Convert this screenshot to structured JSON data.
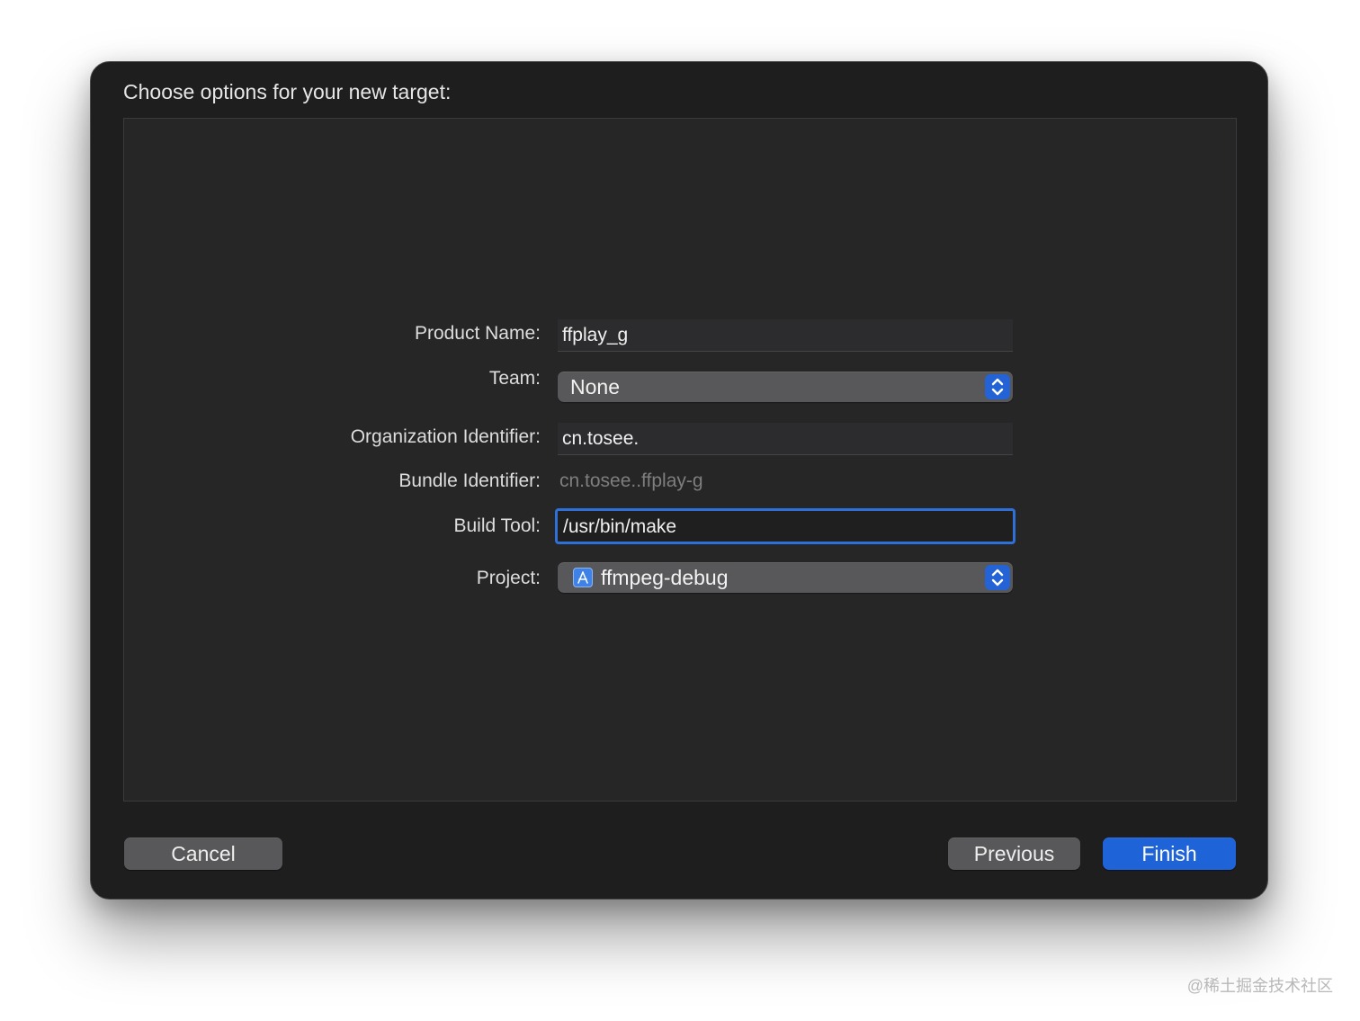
{
  "dialog": {
    "title": "Choose options for your new target:"
  },
  "form": {
    "product_name": {
      "label": "Product Name:",
      "value": "ffplay_g"
    },
    "team": {
      "label": "Team:",
      "value": "None"
    },
    "organization_identifier": {
      "label": "Organization Identifier:",
      "value": "cn.tosee."
    },
    "bundle_identifier": {
      "label": "Bundle Identifier:",
      "value": "cn.tosee..ffplay-g"
    },
    "build_tool": {
      "label": "Build Tool:",
      "value": "/usr/bin/make"
    },
    "project": {
      "label": "Project:",
      "value": "ffmpeg-debug",
      "icon": "xcode-project-icon"
    }
  },
  "buttons": {
    "cancel": "Cancel",
    "previous": "Previous",
    "finish": "Finish"
  },
  "watermark": "@稀土掘金技术社区",
  "colors": {
    "accent": "#1f63d9",
    "dialog_bg": "#1e1e1f",
    "panel_bg": "#262627"
  }
}
